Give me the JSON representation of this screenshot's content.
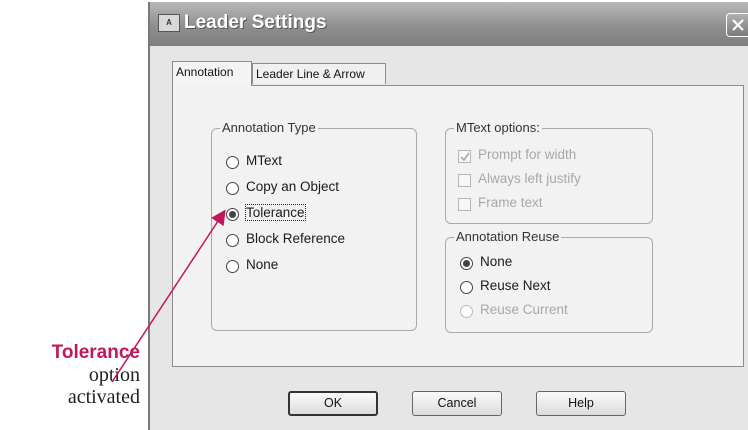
{
  "window": {
    "title": "Leader Settings",
    "icon_text": "A"
  },
  "tabs": [
    {
      "label": "Annotation",
      "active": true
    },
    {
      "label": "Leader Line & Arrow",
      "active": false
    }
  ],
  "annotation_type": {
    "legend": "Annotation Type",
    "options": [
      {
        "label": "MText",
        "selected": false
      },
      {
        "label": "Copy an Object",
        "selected": false
      },
      {
        "label": "Tolerance",
        "selected": true
      },
      {
        "label": "Block Reference",
        "selected": false
      },
      {
        "label": "None",
        "selected": false
      }
    ]
  },
  "mtext_options": {
    "legend": "MText options:",
    "options": [
      {
        "label": "Prompt for width",
        "checked": true,
        "enabled": false
      },
      {
        "label": "Always left justify",
        "checked": false,
        "enabled": false
      },
      {
        "label": "Frame text",
        "checked": false,
        "enabled": false
      }
    ]
  },
  "annotation_reuse": {
    "legend": "Annotation Reuse",
    "options": [
      {
        "label": "None",
        "selected": true,
        "enabled": true
      },
      {
        "label": "Reuse Next",
        "selected": false,
        "enabled": true
      },
      {
        "label": "Reuse Current",
        "selected": false,
        "enabled": false
      }
    ]
  },
  "buttons": {
    "ok": "OK",
    "cancel": "Cancel",
    "help": "Help"
  },
  "callout": {
    "line1": "Tolerance",
    "line2": "option",
    "line3": "activated",
    "accent_color": "#c2185b"
  }
}
